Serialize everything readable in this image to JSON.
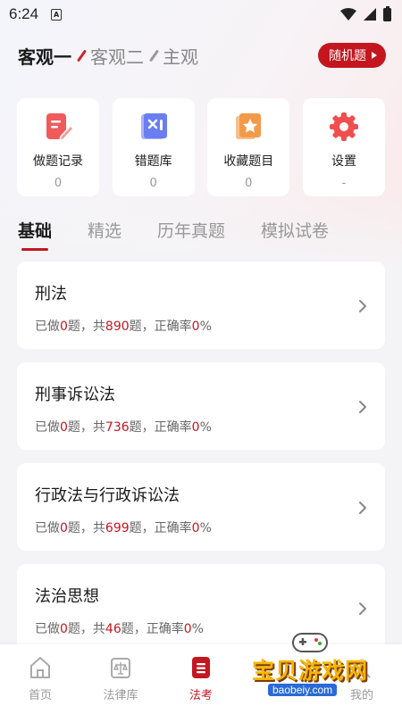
{
  "status_bar": {
    "time": "6:24",
    "sim_label": "A"
  },
  "header": {
    "modes": [
      {
        "label": "客观一",
        "active": true
      },
      {
        "label": "客观二",
        "active": false
      },
      {
        "label": "主观",
        "active": false
      }
    ],
    "random_button": "随机题"
  },
  "quick_actions": [
    {
      "label": "做题记录",
      "count": "0",
      "icon": "edit-record-icon",
      "color": "#ef5b5b"
    },
    {
      "label": "错题库",
      "count": "0",
      "icon": "wrong-questions-icon",
      "color": "#6a7ef0"
    },
    {
      "label": "收藏题目",
      "count": "0",
      "icon": "favorite-star-icon",
      "color": "#f29a4a"
    },
    {
      "label": "设置",
      "count": "-",
      "icon": "gear-icon",
      "color": "#ef4f4f"
    }
  ],
  "category_tabs": [
    {
      "label": "基础",
      "active": true
    },
    {
      "label": "精选",
      "active": false
    },
    {
      "label": "历年真题",
      "active": false
    },
    {
      "label": "模拟试卷",
      "active": false
    }
  ],
  "subjects": [
    {
      "title": "刑法",
      "prefix": "已做",
      "done": "0",
      "mid": "题，共",
      "total": "890",
      "suffix": "题，正确率",
      "rate": "0",
      "pct": "%"
    },
    {
      "title": "刑事诉讼法",
      "prefix": "已做",
      "done": "0",
      "mid": "题，共",
      "total": "736",
      "suffix": "题，正确率",
      "rate": "0",
      "pct": "%"
    },
    {
      "title": "行政法与行政诉讼法",
      "prefix": "已做",
      "done": "0",
      "mid": "题，共",
      "total": "699",
      "suffix": "题，正确率",
      "rate": "0",
      "pct": "%"
    },
    {
      "title": "法治思想",
      "prefix": "已做",
      "done": "0",
      "mid": "题，共",
      "total": "46",
      "suffix": "题，正确率",
      "rate": "0",
      "pct": "%"
    }
  ],
  "bottom_nav": [
    {
      "label": "首页",
      "icon": "home-icon",
      "active": false
    },
    {
      "label": "法律库",
      "icon": "law-library-icon",
      "active": false
    },
    {
      "label": "法考",
      "icon": "exam-icon",
      "active": true
    },
    {
      "label": "",
      "icon": "blank-icon",
      "active": false
    },
    {
      "label": "我的",
      "icon": "profile-icon",
      "active": false
    }
  ],
  "watermark": {
    "text": "宝贝游戏网",
    "url": "baobeiy.com"
  },
  "colors": {
    "accent": "#c4161f",
    "muted": "#999999"
  }
}
